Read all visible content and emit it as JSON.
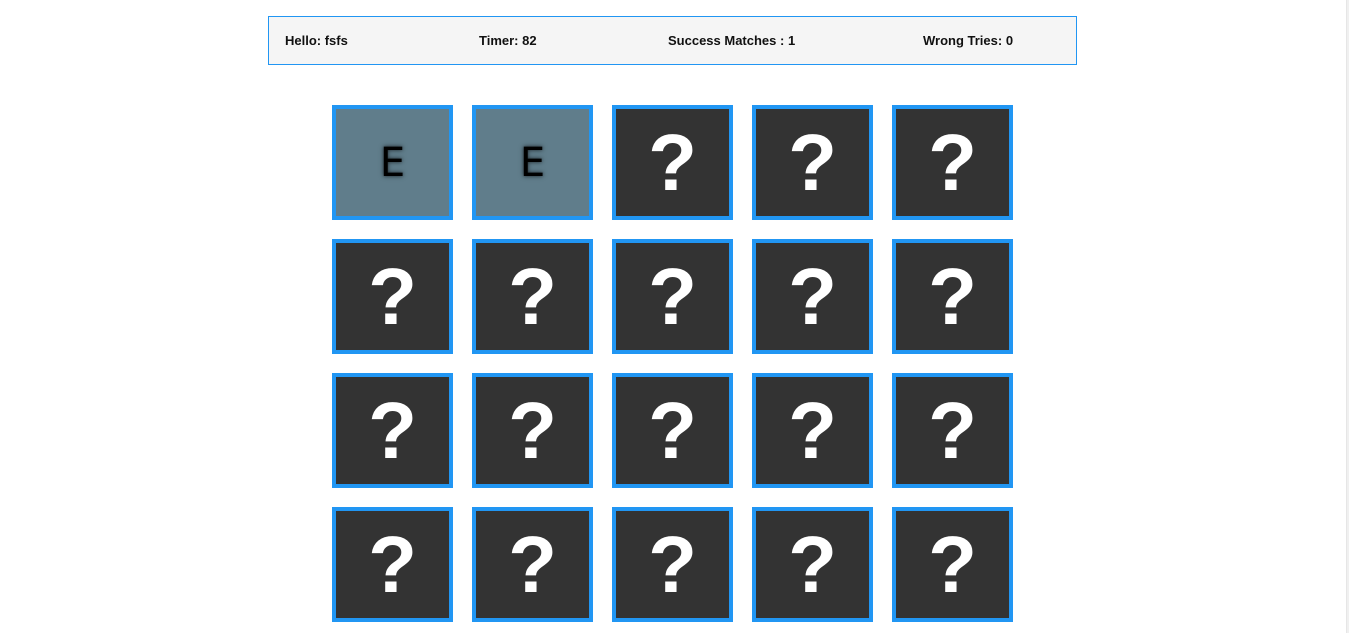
{
  "info": {
    "hello": "Hello: fsfs",
    "timer": "Timer: 82",
    "success": "Success Matches : 1",
    "wrong": "Wrong Tries: 0"
  },
  "colors": {
    "accent": "#2196f3",
    "card_back": "#333333",
    "card_flipped": "#607d8b",
    "info_bg": "#f5f5f5"
  },
  "board": {
    "columns": 5,
    "cards": [
      {
        "face": "E",
        "flipped": true
      },
      {
        "face": "E",
        "flipped": true
      },
      {
        "face": "?",
        "flipped": false
      },
      {
        "face": "?",
        "flipped": false
      },
      {
        "face": "?",
        "flipped": false
      },
      {
        "face": "?",
        "flipped": false
      },
      {
        "face": "?",
        "flipped": false
      },
      {
        "face": "?",
        "flipped": false
      },
      {
        "face": "?",
        "flipped": false
      },
      {
        "face": "?",
        "flipped": false
      },
      {
        "face": "?",
        "flipped": false
      },
      {
        "face": "?",
        "flipped": false
      },
      {
        "face": "?",
        "flipped": false
      },
      {
        "face": "?",
        "flipped": false
      },
      {
        "face": "?",
        "flipped": false
      },
      {
        "face": "?",
        "flipped": false
      },
      {
        "face": "?",
        "flipped": false
      },
      {
        "face": "?",
        "flipped": false
      },
      {
        "face": "?",
        "flipped": false
      },
      {
        "face": "?",
        "flipped": false
      }
    ]
  }
}
